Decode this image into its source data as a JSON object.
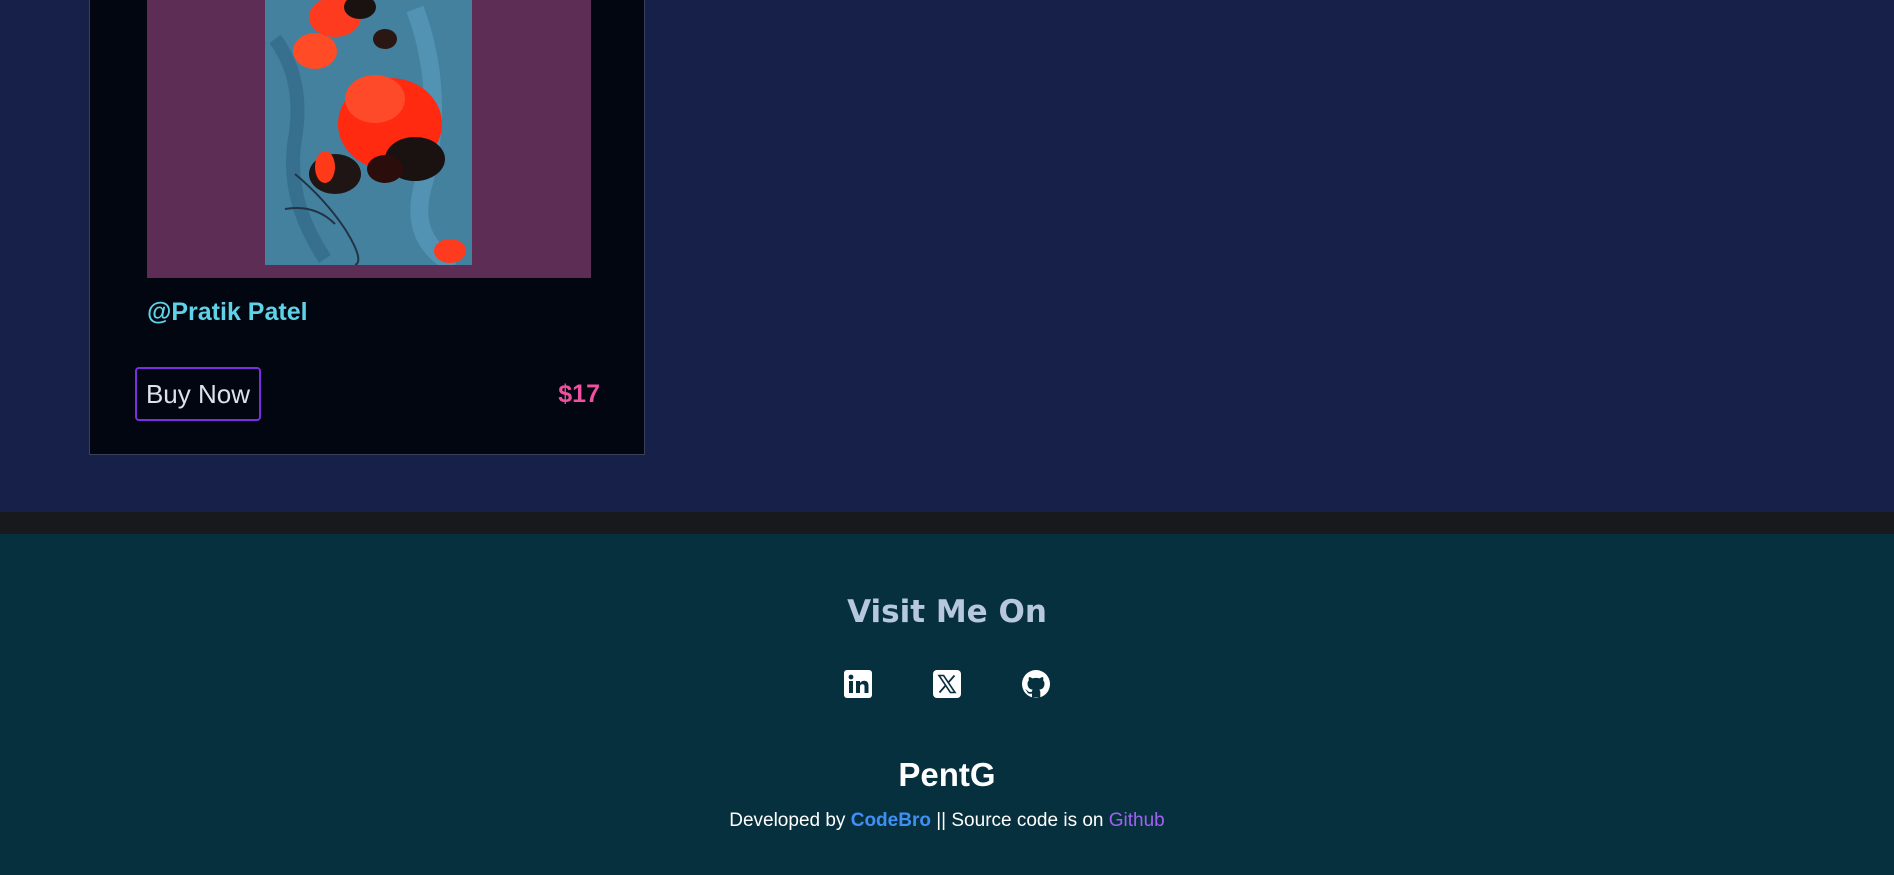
{
  "card": {
    "artist": "@Pratik Patel",
    "buy_label": "Buy Now",
    "price": "$17",
    "frame_color": "#5e2d55"
  },
  "footer": {
    "heading": "Visit Me On",
    "socials": [
      "linkedin-icon",
      "x-twitter-icon",
      "github-icon"
    ],
    "brand": "PentG",
    "credits": {
      "prefix": "Developed by",
      "developer": "CodeBro",
      "middle": "|| Source code is on",
      "source_link": "Github"
    }
  },
  "colors": {
    "page_bg": "#172048",
    "footer_bg": "#07303f",
    "accent_pink": "#f0509f",
    "accent_cyan": "#5fd3e6",
    "accent_purple": "#a062f0",
    "accent_blue": "#3f8ff5"
  }
}
